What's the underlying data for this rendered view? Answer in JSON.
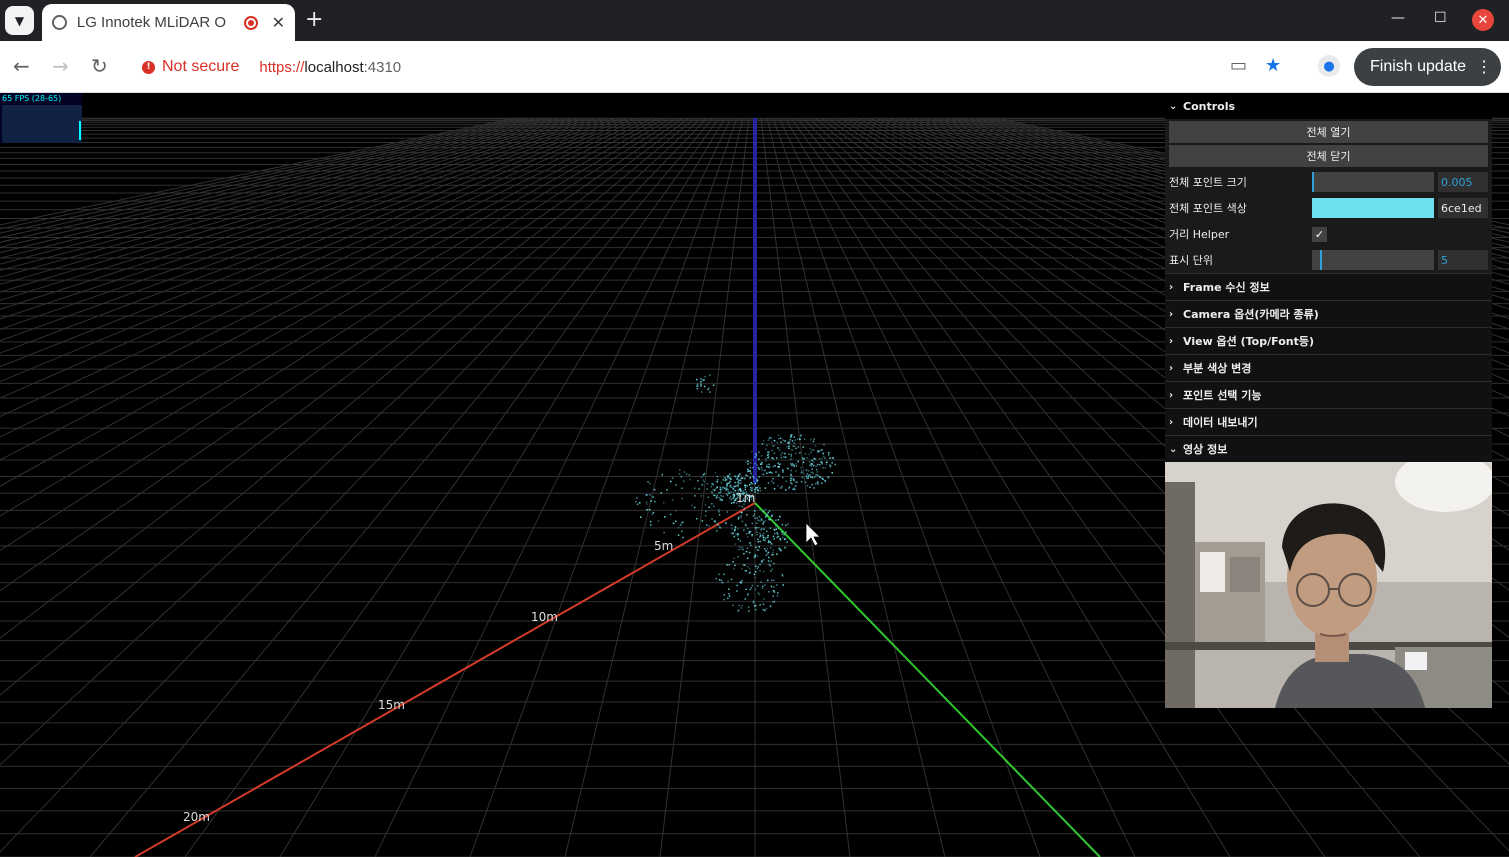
{
  "browser": {
    "tab_title": "LG Innotek MLiDAR O",
    "new_tab": "+",
    "tab_close": "✕",
    "security_label": "Not secure",
    "url_scheme": "https://",
    "url_host": "localhost",
    "url_port": ":4310",
    "finish_update_label": "Finish update"
  },
  "stats": {
    "fps_text": "65 FPS (28-65)"
  },
  "scene": {
    "axis_labels": [
      "1m",
      "5m",
      "10m",
      "15m",
      "20m"
    ],
    "colors": {
      "x_axis": "#d23a2a",
      "y_axis": "#2fc92f",
      "z_axis": "#2a2aa8",
      "points": "#6ce1ed",
      "grid": "#3a3a3a"
    }
  },
  "gui": {
    "title": "Controls",
    "open_all_label": "전체 열기",
    "close_all_label": "전체 닫기",
    "point_size": {
      "label": "전체 포인트 크기",
      "value": "0.005"
    },
    "point_color": {
      "label": "전체 포인트 색상",
      "value": "6ce1ed",
      "swatch": "#6ce1ed"
    },
    "distance_helper": {
      "label": "거리 Helper",
      "checked": true
    },
    "display_unit": {
      "label": "표시 단위",
      "value": "5"
    },
    "folders": [
      {
        "label": "Frame 수신 정보",
        "open": false
      },
      {
        "label": "Camera 옵션(카메라 종류)",
        "open": false
      },
      {
        "label": "View 옵션 (Top/Font등)",
        "open": false
      },
      {
        "label": "부분 색상 변경",
        "open": false
      },
      {
        "label": "포인트 선택 기능",
        "open": false
      },
      {
        "label": "데이터 내보내기",
        "open": false
      },
      {
        "label": "영상 정보",
        "open": true
      }
    ]
  }
}
